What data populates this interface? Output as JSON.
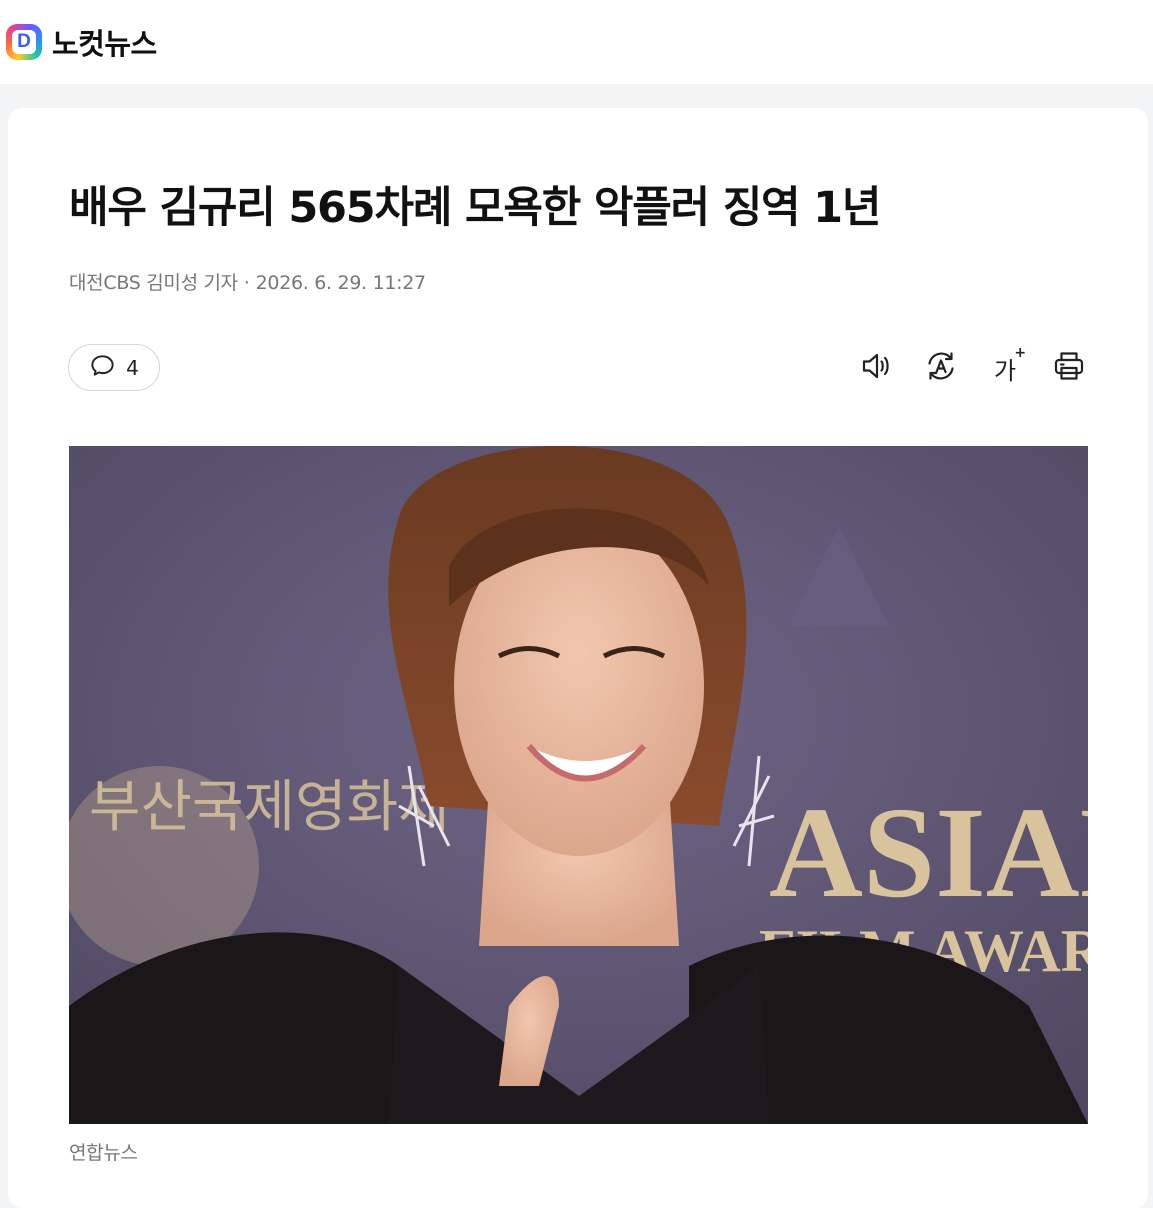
{
  "header": {
    "logo_letter": "D",
    "brand_name": "노컷뉴스"
  },
  "article": {
    "title": "배우 김규리 565차례 모욕한 악플러 징역 1년",
    "byline": {
      "reporter": "대전CBS 김미성 기자",
      "separator": "·",
      "datetime": "2026. 6. 29. 11:27"
    },
    "comment_count": "4",
    "toolbar": {
      "font_size_label": "가",
      "font_size_plus": "+"
    },
    "photo": {
      "backdrop_left_text": "부산국제영화제",
      "backdrop_right_line1": "ASIAN",
      "backdrop_right_line2": "FILM AWARD",
      "caption": "연합뉴스"
    }
  },
  "colors": {
    "brand_blue": "#3a5bff",
    "backdrop_purple": "#5e5674",
    "gold_text": "#d8c39c",
    "meta_gray": "#777777"
  },
  "icons": [
    "comment-bubble-icon",
    "speaker-icon",
    "translate-icon",
    "font-size-icon",
    "print-icon"
  ]
}
